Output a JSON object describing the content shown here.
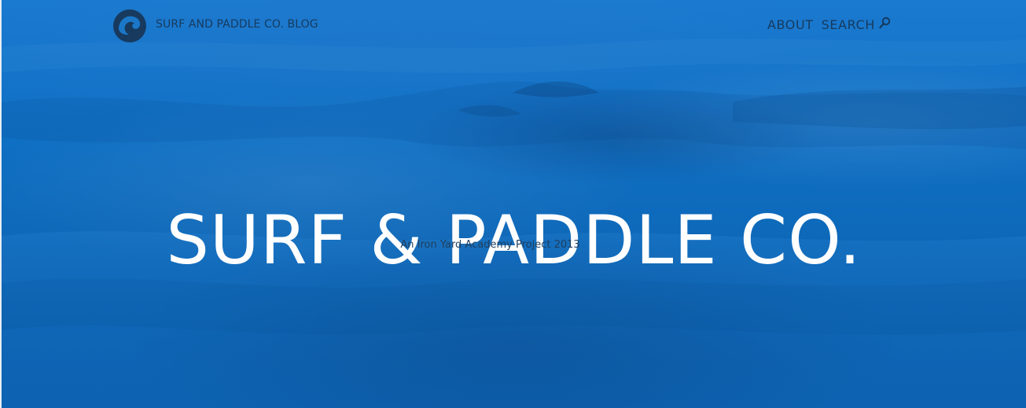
{
  "header": {
    "brand_label": "SURF AND PADDLE CO. BLOG",
    "logo_icon": "wave-logo-icon",
    "nav": {
      "about_label": "ABOUT",
      "search_label": "SEARCH",
      "search_icon": "search-icon"
    }
  },
  "hero": {
    "title": "SURF & PADDLE CO.",
    "subtitle": "An Iron Yard Academy Project 2013"
  },
  "colors": {
    "background": "#0e68b8",
    "nav_text": "#173a5e",
    "title_text": "#ffffff",
    "logo": "#173a5e"
  }
}
